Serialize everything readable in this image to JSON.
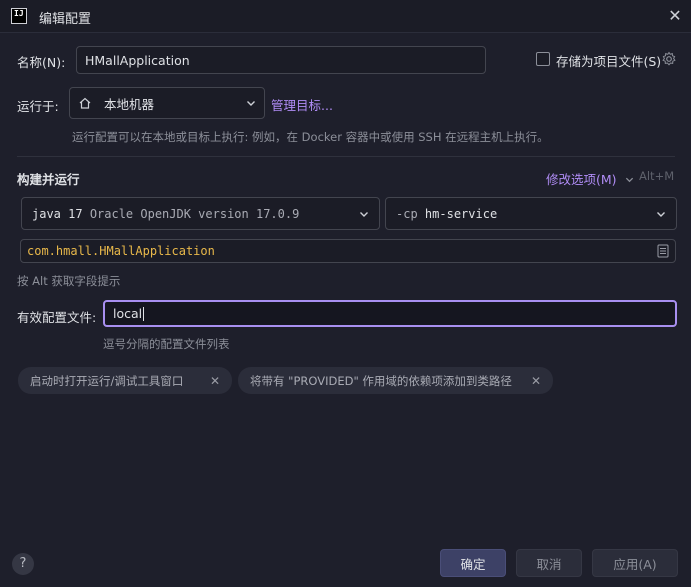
{
  "window": {
    "title": "编辑配置",
    "app_icon_text": "IJ"
  },
  "name_field": {
    "label": "名称(N):",
    "value": "HMallApplication"
  },
  "store_as_project_file": {
    "label": "存储为项目文件(S)",
    "checked": false
  },
  "run_on": {
    "label": "运行于:",
    "value": "本地机器",
    "manage_link": "管理目标...",
    "hint": "运行配置可以在本地或目标上执行: 例如，在 Docker 容器中或使用 SSH 在远程主机上执行。"
  },
  "build_section": {
    "title": "构建并运行",
    "modify_options": "修改选项(M)",
    "shortcut": "Alt+M"
  },
  "jdk_select": {
    "value": "java 17 Oracle OpenJDK version 17.0.9",
    "java": "java 17",
    "detail": "Oracle OpenJDK version 17.0.9"
  },
  "classpath_select": {
    "prefix": "-cp",
    "module": "hm-service"
  },
  "main_class": {
    "value": "com.hmall.HMallApplication",
    "hint": "按 Alt 获取字段提示"
  },
  "active_profiles": {
    "label": "有效配置文件:",
    "value": "local",
    "hint": "逗号分隔的配置文件列表"
  },
  "chips": [
    {
      "label": "启动时打开运行/调试工具窗口"
    },
    {
      "label": "将带有 \"PROVIDED\" 作用域的依赖项添加到类路径"
    }
  ],
  "footer": {
    "help": "?",
    "ok": "确定",
    "cancel": "取消",
    "apply": "应用(A)"
  },
  "colors": {
    "background": "#1e1f2b",
    "accent": "#b08cf5",
    "focus_border": "#a88ff0",
    "primary_button": "#3d4166"
  }
}
